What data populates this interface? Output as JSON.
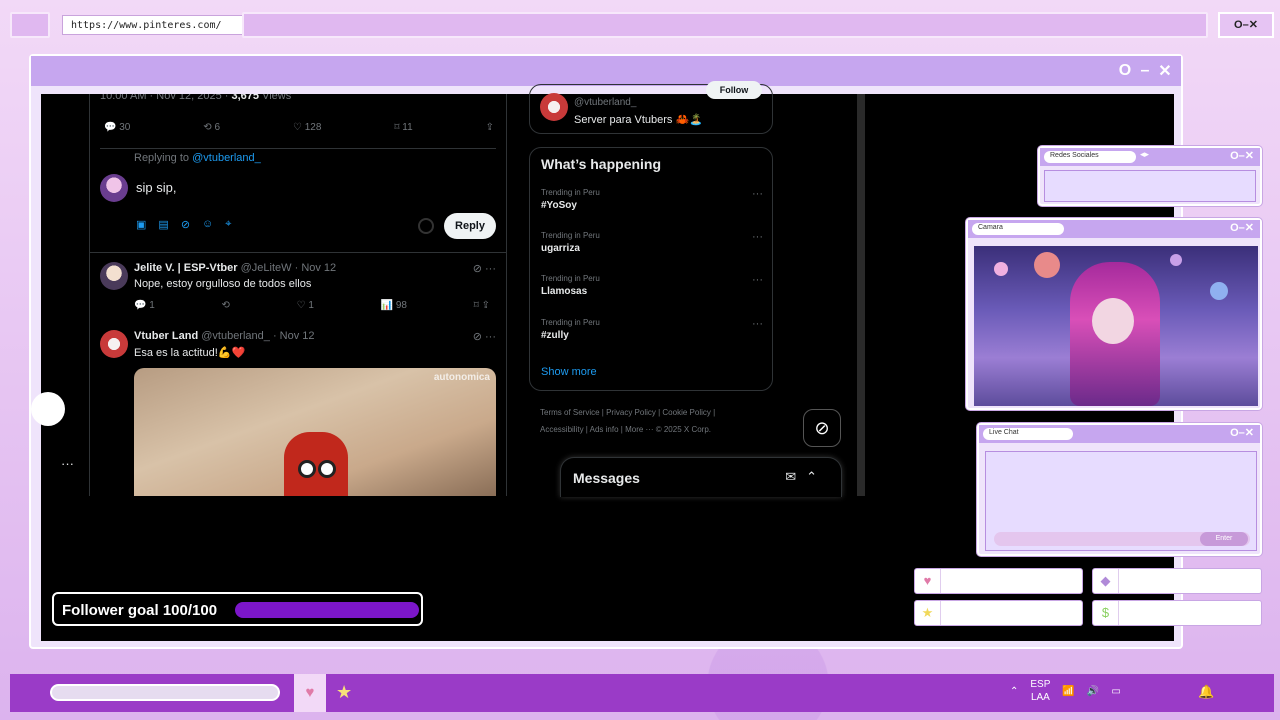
{
  "browser": {
    "url": "https://www.pinteres.com/",
    "controls": "O–✕"
  },
  "main_window": {
    "controls": [
      "O",
      "–",
      "✕"
    ]
  },
  "tweet_top": {
    "meta_prefix": "10:00 AM · Nov 12, 2025 ·",
    "views": "3,675",
    "views_label": "Views",
    "actions": {
      "replies": "30",
      "reposts": "6",
      "likes": "128",
      "bookmarks": "11"
    }
  },
  "reply_box": {
    "replying_to_prefix": "Replying to",
    "replying_to_handle": "@vtuberland_",
    "text": "sip sip,",
    "reply_button": "Reply"
  },
  "tweets": [
    {
      "name": "Jelite V. | ESP-Vtber",
      "handle": "@JeLiteW",
      "date": "· Nov 12",
      "body": "Nope, estoy orgulloso de todos ellos",
      "replies": "1",
      "reposts": "",
      "likes": "1",
      "views": "98"
    },
    {
      "name": "Vtuber Land",
      "handle": "@vtuberland_",
      "date": "· Nov 12",
      "body": "Esa es la actitud!💪❤️"
    }
  ],
  "media": {
    "watermark": "autonomica"
  },
  "follow_card": {
    "handle": "@vtuberland_",
    "description": "Server para Vtubers 🦀🏝️",
    "button": "Follow"
  },
  "whats_happening": {
    "title": "What’s happening",
    "trends": [
      {
        "context": "Trending in Peru",
        "name": "#YoSoy"
      },
      {
        "context": "Trending in Peru",
        "name": "ugarriza"
      },
      {
        "context": "Trending in Peru",
        "name": "Llamosas"
      },
      {
        "context": "Trending in Peru",
        "name": "#zully"
      }
    ],
    "show_more": "Show more"
  },
  "footer_links": {
    "line1": "Terms of Service  |  Privacy Policy  |  Cookie Policy  |",
    "line2": "Accessibility  |  Ads info  |  More ···  © 2025 X Corp."
  },
  "messages": {
    "title": "Messages"
  },
  "follower_goal": {
    "label": "Follower goal 100/100",
    "current": 100,
    "target": 100,
    "bar_color": "#7c16c9"
  },
  "panels": {
    "social": {
      "title": "Redes Sociales"
    },
    "camera": {
      "title": "Camara"
    },
    "chat": {
      "title": "Live Chat",
      "enter": "Enter"
    }
  },
  "taskbar": {
    "lang_top": "ESP",
    "lang_bottom": "LAA",
    "accent": "#9a3bc7"
  }
}
